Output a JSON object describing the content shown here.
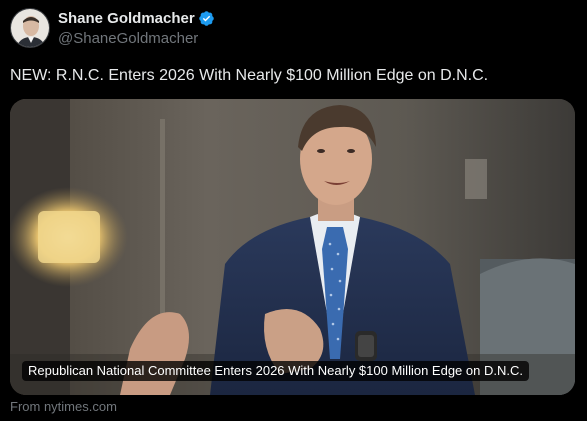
{
  "author": {
    "name": "Shane Goldmacher",
    "handle": "@ShaneGoldmacher",
    "verified": true
  },
  "tweet": {
    "text": "NEW: R.N.C. Enters 2026 With Nearly $100 Million Edge on D.N.C."
  },
  "card": {
    "caption": "Republican National Committee Enters 2026 With Nearly $100 Million Edge on D.N.C.",
    "source": "From nytimes.com"
  },
  "colors": {
    "background": "#000000",
    "text": "#e7e9ea",
    "muted": "#71767b",
    "verified": "#1d9bf0"
  },
  "icons": {
    "verified": "verified-badge-icon"
  }
}
